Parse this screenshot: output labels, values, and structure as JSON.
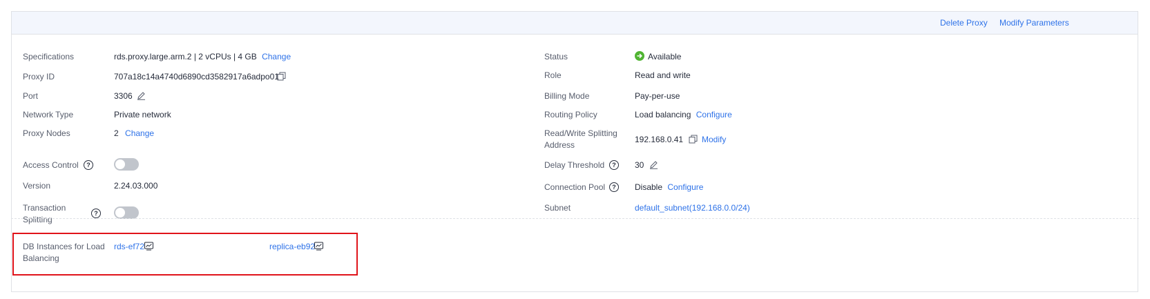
{
  "toolbar": {
    "delete_proxy": "Delete Proxy",
    "modify_parameters": "Modify Parameters"
  },
  "left": {
    "specifications": {
      "label": "Specifications",
      "value": "rds.proxy.large.arm.2 | 2 vCPUs | 4 GB",
      "action": "Change"
    },
    "proxy_id": {
      "label": "Proxy ID",
      "value": "707a18c14a4740d6890cd3582917a6adpo01"
    },
    "port": {
      "label": "Port",
      "value": "3306"
    },
    "network_type": {
      "label": "Network Type",
      "value": "Private network"
    },
    "proxy_nodes": {
      "label": "Proxy Nodes",
      "value": "2",
      "action": "Change"
    },
    "access_control": {
      "label": "Access Control",
      "enabled": false
    },
    "version": {
      "label": "Version",
      "value": "2.24.03.000"
    },
    "transaction_splitting": {
      "label_line1": "Transaction",
      "label_line2": "Splitting",
      "enabled": false
    },
    "db_instances": {
      "label_line1": "DB Instances for Load",
      "label_line2": "Balancing",
      "items": [
        "rds-ef72",
        "replica-eb92"
      ]
    }
  },
  "right": {
    "status": {
      "label": "Status",
      "value": "Available",
      "color": "#50b432"
    },
    "role": {
      "label": "Role",
      "value": "Read and write"
    },
    "billing_mode": {
      "label": "Billing Mode",
      "value": "Pay-per-use"
    },
    "routing_policy": {
      "label": "Routing Policy",
      "value": "Load balancing",
      "action": "Configure"
    },
    "rw_address": {
      "label_line1": "Read/Write Splitting",
      "label_line2": "Address",
      "value": "192.168.0.41",
      "action": "Modify"
    },
    "delay_threshold": {
      "label": "Delay Threshold",
      "value": "30"
    },
    "connection_pool": {
      "label": "Connection Pool",
      "value": "Disable",
      "action": "Configure"
    },
    "subnet": {
      "label": "Subnet",
      "value": "default_subnet(192.168.0.0/24)"
    }
  },
  "help_glyph": "?",
  "colors": {
    "link": "#2e72e8",
    "highlight": "#e0131a",
    "toolbar_bg": "#f3f6fd"
  }
}
